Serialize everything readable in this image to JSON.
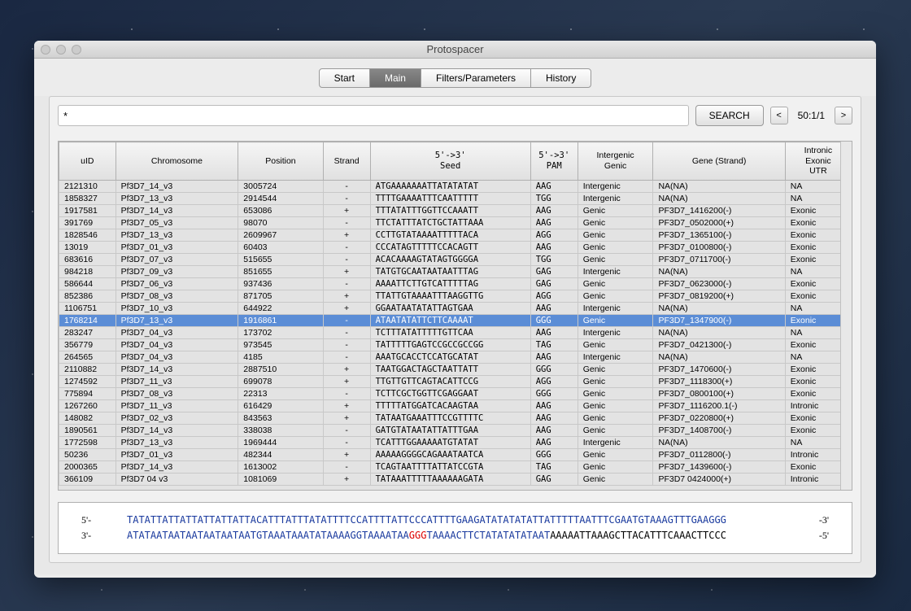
{
  "window": {
    "title": "Protospacer"
  },
  "tabs": {
    "items": [
      "Start",
      "Main",
      "Filters/Parameters",
      "History"
    ],
    "active": 1
  },
  "search": {
    "value": "*",
    "button": "SEARCH",
    "page": "50:1/1",
    "prev": "<",
    "next": ">"
  },
  "table": {
    "headers": [
      "uID",
      "Chromosome",
      "Position",
      "Strand",
      "5'->3'\nSeed",
      "5'->3'\nPAM",
      "Intergenic\nGenic",
      "Gene (Strand)",
      "Intronic\nExonic\nUTR"
    ],
    "selected_index": 11,
    "rows": [
      {
        "uid": "2121310",
        "chr": "Pf3D7_14_v3",
        "pos": "3005724",
        "strand": "-",
        "seed": "ATGAAAAAAATTATATATAT",
        "pam": "AAG",
        "ig": "Intergenic",
        "gene": "NA(NA)",
        "iex": "NA"
      },
      {
        "uid": "1858327",
        "chr": "Pf3D7_13_v3",
        "pos": "2914544",
        "strand": "-",
        "seed": "TTTTGAAAATTTCAATTTTT",
        "pam": "TGG",
        "ig": "Intergenic",
        "gene": "NA(NA)",
        "iex": "NA"
      },
      {
        "uid": "1917581",
        "chr": "Pf3D7_14_v3",
        "pos": "653086",
        "strand": "+",
        "seed": "TTTATATTTGGTTCCAAATT",
        "pam": "AAG",
        "ig": "Genic",
        "gene": "PF3D7_1416200(-)",
        "iex": "Exonic"
      },
      {
        "uid": "391769",
        "chr": "Pf3D7_05_v3",
        "pos": "98070",
        "strand": "-",
        "seed": "TTCTATTTATCTGCTATTAAA",
        "pam": "AAG",
        "ig": "Genic",
        "gene": "PF3D7_0502000(+)",
        "iex": "Exonic"
      },
      {
        "uid": "1828546",
        "chr": "Pf3D7_13_v3",
        "pos": "2609967",
        "strand": "+",
        "seed": "CCTTGTATAAAATTTTTACA",
        "pam": "AGG",
        "ig": "Genic",
        "gene": "PF3D7_1365100(-)",
        "iex": "Exonic"
      },
      {
        "uid": "13019",
        "chr": "Pf3D7_01_v3",
        "pos": "60403",
        "strand": "-",
        "seed": "CCCATAGTTTTTCCACAGTT",
        "pam": "AAG",
        "ig": "Genic",
        "gene": "PF3D7_0100800(-)",
        "iex": "Exonic"
      },
      {
        "uid": "683616",
        "chr": "Pf3D7_07_v3",
        "pos": "515655",
        "strand": "-",
        "seed": "ACACAAAAGTATAGTGGGGA",
        "pam": "TGG",
        "ig": "Genic",
        "gene": "PF3D7_0711700(-)",
        "iex": "Exonic"
      },
      {
        "uid": "984218",
        "chr": "Pf3D7_09_v3",
        "pos": "851655",
        "strand": "+",
        "seed": "TATGTGCAATAATAATTTAG",
        "pam": "GAG",
        "ig": "Intergenic",
        "gene": "NA(NA)",
        "iex": "NA"
      },
      {
        "uid": "586644",
        "chr": "Pf3D7_06_v3",
        "pos": "937436",
        "strand": "-",
        "seed": "AAAATTCTTGTCATTTTTAG",
        "pam": "GAG",
        "ig": "Genic",
        "gene": "PF3D7_0623000(-)",
        "iex": "Exonic"
      },
      {
        "uid": "852386",
        "chr": "Pf3D7_08_v3",
        "pos": "871705",
        "strand": "+",
        "seed": "TTATTGTAAAATTTAAGGTTG",
        "pam": "AGG",
        "ig": "Genic",
        "gene": "PF3D7_0819200(+)",
        "iex": "Exonic"
      },
      {
        "uid": "1106751",
        "chr": "Pf3D7_10_v3",
        "pos": "644922",
        "strand": "+",
        "seed": "GGAATAATATATTAGTGAA",
        "pam": "AAG",
        "ig": "Intergenic",
        "gene": "NA(NA)",
        "iex": "NA"
      },
      {
        "uid": "1768214",
        "chr": "Pf3D7_13_v3",
        "pos": "1916861",
        "strand": "-",
        "seed": "ATAATATATTCTTCAAAAT",
        "pam": "GGG",
        "ig": "Genic",
        "gene": "PF3D7_1347900(-)",
        "iex": "Exonic"
      },
      {
        "uid": "283247",
        "chr": "Pf3D7_04_v3",
        "pos": "173702",
        "strand": "-",
        "seed": "TCTTTATATTTTTGTTCAA",
        "pam": "AAG",
        "ig": "Intergenic",
        "gene": "NA(NA)",
        "iex": "NA"
      },
      {
        "uid": "356779",
        "chr": "Pf3D7_04_v3",
        "pos": "973545",
        "strand": "-",
        "seed": "TATTTTTGAGTCCGCCGCCGG",
        "pam": "TAG",
        "ig": "Genic",
        "gene": "PF3D7_0421300(-)",
        "iex": "Exonic"
      },
      {
        "uid": "264565",
        "chr": "Pf3D7_04_v3",
        "pos": "4185",
        "strand": "-",
        "seed": "AAATGCACCTCCATGCATAT",
        "pam": "AAG",
        "ig": "Intergenic",
        "gene": "NA(NA)",
        "iex": "NA"
      },
      {
        "uid": "2110882",
        "chr": "Pf3D7_14_v3",
        "pos": "2887510",
        "strand": "+",
        "seed": "TAATGGACTAGCTAATTATT",
        "pam": "GGG",
        "ig": "Genic",
        "gene": "PF3D7_1470600(-)",
        "iex": "Exonic"
      },
      {
        "uid": "1274592",
        "chr": "Pf3D7_11_v3",
        "pos": "699078",
        "strand": "+",
        "seed": "TTGTTGTTCAGTACATTCCG",
        "pam": "AGG",
        "ig": "Genic",
        "gene": "PF3D7_1118300(+)",
        "iex": "Exonic"
      },
      {
        "uid": "775894",
        "chr": "Pf3D7_08_v3",
        "pos": "22313",
        "strand": "-",
        "seed": "TCTTCGCTGGTTCGAGGAAT",
        "pam": "GGG",
        "ig": "Genic",
        "gene": "PF3D7_0800100(+)",
        "iex": "Exonic"
      },
      {
        "uid": "1267260",
        "chr": "Pf3D7_11_v3",
        "pos": "616429",
        "strand": "+",
        "seed": "TTTTTATGGATCACAAGTAA",
        "pam": "AAG",
        "ig": "Genic",
        "gene": "PF3D7_1116200.1(-)",
        "iex": "Intronic"
      },
      {
        "uid": "148082",
        "chr": "Pf3D7_02_v3",
        "pos": "843563",
        "strand": "+",
        "seed": "TATAATGAAATTTCCGTTTTC",
        "pam": "AAG",
        "ig": "Genic",
        "gene": "PF3D7_0220800(+)",
        "iex": "Exonic"
      },
      {
        "uid": "1890561",
        "chr": "Pf3D7_14_v3",
        "pos": "338038",
        "strand": "-",
        "seed": "GATGTATAATATTATTTGAA",
        "pam": "AAG",
        "ig": "Genic",
        "gene": "PF3D7_1408700(-)",
        "iex": "Exonic"
      },
      {
        "uid": "1772598",
        "chr": "Pf3D7_13_v3",
        "pos": "1969444",
        "strand": "-",
        "seed": "TCATTTGGAAAAATGTATAT",
        "pam": "AAG",
        "ig": "Intergenic",
        "gene": "NA(NA)",
        "iex": "NA"
      },
      {
        "uid": "50236",
        "chr": "Pf3D7_01_v3",
        "pos": "482344",
        "strand": "+",
        "seed": "AAAAAGGGGCAGAAATAATCA",
        "pam": "GGG",
        "ig": "Genic",
        "gene": "PF3D7_0112800(-)",
        "iex": "Intronic"
      },
      {
        "uid": "2000365",
        "chr": "Pf3D7_14_v3",
        "pos": "1613002",
        "strand": "-",
        "seed": "TCAGTAATTTTATTATCCGTA",
        "pam": "TAG",
        "ig": "Genic",
        "gene": "PF3D7_1439600(-)",
        "iex": "Exonic"
      },
      {
        "uid": "366109",
        "chr": "Pf3D7 04 v3",
        "pos": "1081069",
        "strand": "+",
        "seed": "TATAAATTTTTAAAAAAGATA",
        "pam": "GAG",
        "ig": "Genic",
        "gene": "PF3D7 0424000(+)",
        "iex": "Intronic"
      }
    ]
  },
  "sequence": {
    "row1": {
      "label": "5'-",
      "end": "-3'",
      "segments": [
        {
          "t": "TATATTATTATTATTATTATTACATTTATTTATATTTTCCATTTTATTCCCATTTTGAAGATATATATATTATTTTTAATTTCGAATGTAAAGTTTGAAGGG",
          "c": "blue"
        }
      ]
    },
    "row2": {
      "label": "3'-",
      "end": "-5'",
      "segments": [
        {
          "t": "ATATAATAATAATAATAATAATGTAAATAAATATAAAAGGTAAAATAA",
          "c": "blue"
        },
        {
          "t": "GGG",
          "c": "red"
        },
        {
          "t": "TAAAACTTCTATATATATAAT",
          "c": "blue"
        },
        {
          "t": "AAAAATTAAAGCTTACATTTCAAACTTCCC",
          "c": "black"
        }
      ]
    }
  }
}
